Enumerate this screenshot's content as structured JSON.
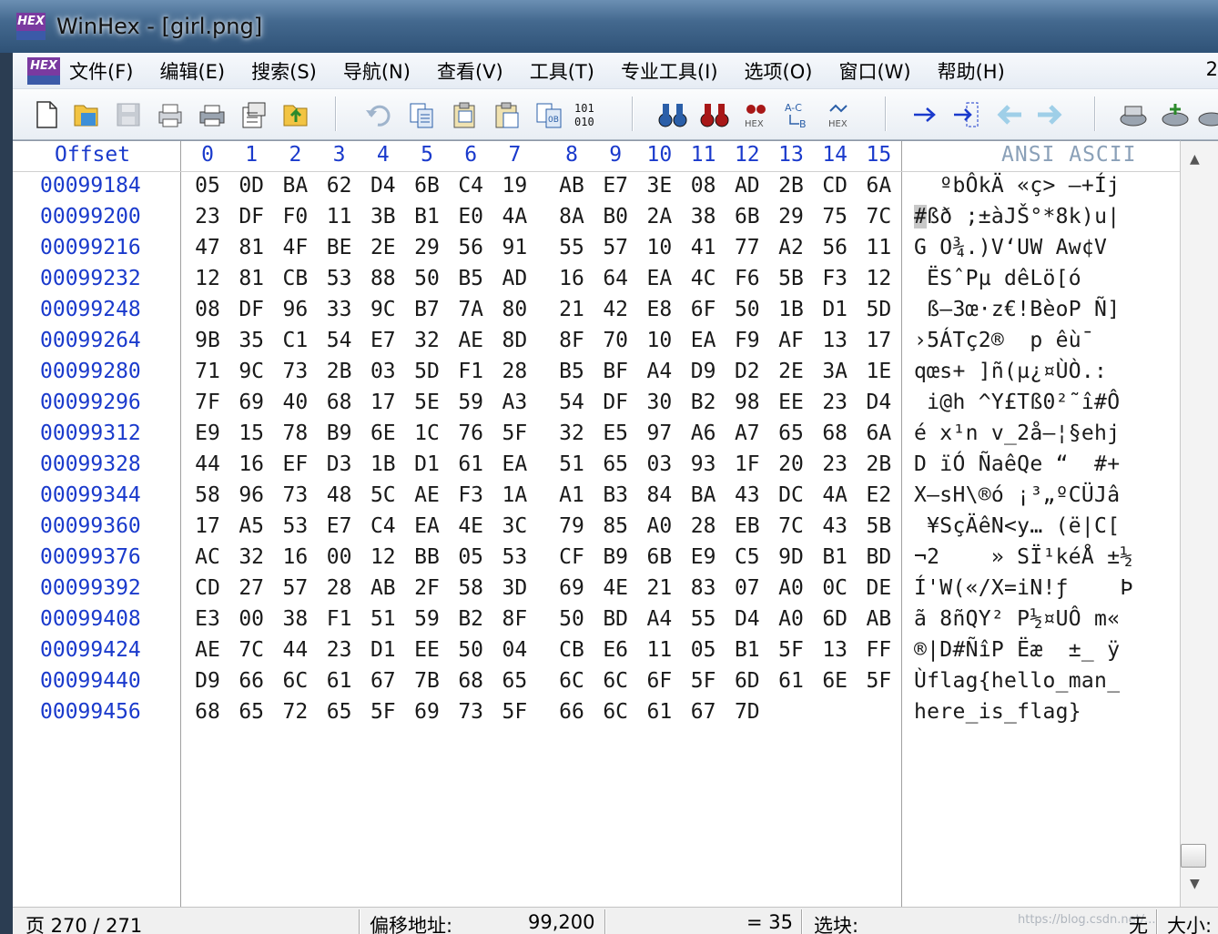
{
  "window": {
    "title": "WinHex - [girl.png]",
    "logo_text": "HEX"
  },
  "menu": {
    "items": [
      "文件(F)",
      "编辑(E)",
      "搜索(S)",
      "导航(N)",
      "查看(V)",
      "工具(T)",
      "专业工具(I)",
      "选项(O)",
      "窗口(W)",
      "帮助(H)"
    ],
    "right_text": "2"
  },
  "toolbar": {
    "icons": [
      "new-file-icon",
      "open-file-icon",
      "save-icon",
      "print-setup-icon",
      "print-icon",
      "properties-icon",
      "export-icon",
      "undo-icon",
      "copy-icon",
      "paste-special-icon",
      "clipboard-icon",
      "copy-hex-icon",
      "binary-convert-icon",
      "find-text-icon",
      "find-hex-icon",
      "replace-hex-icon",
      "replace-text-icon",
      "go-to-hex-icon",
      "goto-offset-icon",
      "goto-block-icon",
      "back-icon",
      "forward-icon",
      "disk-icon",
      "disk-add-icon",
      "disk-open-icon"
    ],
    "binary_text": "101\n010",
    "hex_text": "HEX"
  },
  "hex": {
    "offset_label": "Offset",
    "ansi_label": "ANSI ASCII",
    "columns": [
      "0",
      "1",
      "2",
      "3",
      "4",
      "5",
      "6",
      "7",
      "8",
      "9",
      "10",
      "11",
      "12",
      "13",
      "14",
      "15"
    ],
    "rows": [
      {
        "offset": "00099184",
        "bytes": [
          "05",
          "0D",
          "BA",
          "62",
          "D4",
          "6B",
          "C4",
          "19",
          "AB",
          "E7",
          "3E",
          "08",
          "AD",
          "2B",
          "CD",
          "6A"
        ],
        "ascii": "  ºbÔkÄ «ç> –+Íj"
      },
      {
        "offset": "00099200",
        "bytes": [
          "23",
          "DF",
          "F0",
          "11",
          "3B",
          "B1",
          "E0",
          "4A",
          "8A",
          "B0",
          "2A",
          "38",
          "6B",
          "29",
          "75",
          "7C"
        ],
        "ascii": "#ßð ;±àJŠ°*8k)u|"
      },
      {
        "offset": "00099216",
        "bytes": [
          "47",
          "81",
          "4F",
          "BE",
          "2E",
          "29",
          "56",
          "91",
          "55",
          "57",
          "10",
          "41",
          "77",
          "A2",
          "56",
          "11"
        ],
        "ascii": "G O¾.)V‘UW Aw¢V"
      },
      {
        "offset": "00099232",
        "bytes": [
          "12",
          "81",
          "CB",
          "53",
          "88",
          "50",
          "B5",
          "AD",
          "16",
          "64",
          "EA",
          "4C",
          "F6",
          "5B",
          "F3",
          "12"
        ],
        "ascii": " ËSˆPµ­ dêLö[ó"
      },
      {
        "offset": "00099248",
        "bytes": [
          "08",
          "DF",
          "96",
          "33",
          "9C",
          "B7",
          "7A",
          "80",
          "21",
          "42",
          "E8",
          "6F",
          "50",
          "1B",
          "D1",
          "5D"
        ],
        "ascii": " ß–3œ·z€!BèoP Ñ]"
      },
      {
        "offset": "00099264",
        "bytes": [
          "9B",
          "35",
          "C1",
          "54",
          "E7",
          "32",
          "AE",
          "8D",
          "8F",
          "70",
          "10",
          "EA",
          "F9",
          "AF",
          "13",
          "17"
        ],
        "ascii": "›5ÁTç2®  p êù¯"
      },
      {
        "offset": "00099280",
        "bytes": [
          "71",
          "9C",
          "73",
          "2B",
          "03",
          "5D",
          "F1",
          "28",
          "B5",
          "BF",
          "A4",
          "D9",
          "D2",
          "2E",
          "3A",
          "1E"
        ],
        "ascii": "qœs+ ]ñ(µ¿¤ÙÒ.:"
      },
      {
        "offset": "00099296",
        "bytes": [
          "7F",
          "69",
          "40",
          "68",
          "17",
          "5E",
          "59",
          "A3",
          "54",
          "DF",
          "30",
          "B2",
          "98",
          "EE",
          "23",
          "D4"
        ],
        "ascii": " i@h ^Y£Tß0²˜î#Ô"
      },
      {
        "offset": "00099312",
        "bytes": [
          "E9",
          "15",
          "78",
          "B9",
          "6E",
          "1C",
          "76",
          "5F",
          "32",
          "E5",
          "97",
          "A6",
          "A7",
          "65",
          "68",
          "6A"
        ],
        "ascii": "é x¹n v_2å—¦§ehj"
      },
      {
        "offset": "00099328",
        "bytes": [
          "44",
          "16",
          "EF",
          "D3",
          "1B",
          "D1",
          "61",
          "EA",
          "51",
          "65",
          "03",
          "93",
          "1F",
          "20",
          "23",
          "2B"
        ],
        "ascii": "D ïÓ ÑaêQe “  #+"
      },
      {
        "offset": "00099344",
        "bytes": [
          "58",
          "96",
          "73",
          "48",
          "5C",
          "AE",
          "F3",
          "1A",
          "A1",
          "B3",
          "84",
          "BA",
          "43",
          "DC",
          "4A",
          "E2"
        ],
        "ascii": "X–sH\\®ó ¡³„ºCÜJâ"
      },
      {
        "offset": "00099360",
        "bytes": [
          "17",
          "A5",
          "53",
          "E7",
          "C4",
          "EA",
          "4E",
          "3C",
          "79",
          "85",
          "A0",
          "28",
          "EB",
          "7C",
          "43",
          "5B"
        ],
        "ascii": " ¥SçÄêN<y… (ë|C["
      },
      {
        "offset": "00099376",
        "bytes": [
          "AC",
          "32",
          "16",
          "00",
          "12",
          "BB",
          "05",
          "53",
          "CF",
          "B9",
          "6B",
          "E9",
          "C5",
          "9D",
          "B1",
          "BD"
        ],
        "ascii": "¬2    » SÏ¹kéÅ ±½"
      },
      {
        "offset": "00099392",
        "bytes": [
          "CD",
          "27",
          "57",
          "28",
          "AB",
          "2F",
          "58",
          "3D",
          "69",
          "4E",
          "21",
          "83",
          "07",
          "A0",
          "0C",
          "DE"
        ],
        "ascii": "Í'W(«/X=iN!ƒ    Þ"
      },
      {
        "offset": "00099408",
        "bytes": [
          "E3",
          "00",
          "38",
          "F1",
          "51",
          "59",
          "B2",
          "8F",
          "50",
          "BD",
          "A4",
          "55",
          "D4",
          "A0",
          "6D",
          "AB"
        ],
        "ascii": "ã 8ñQY² P½¤UÔ m«"
      },
      {
        "offset": "00099424",
        "bytes": [
          "AE",
          "7C",
          "44",
          "23",
          "D1",
          "EE",
          "50",
          "04",
          "CB",
          "E6",
          "11",
          "05",
          "B1",
          "5F",
          "13",
          "FF"
        ],
        "ascii": "®|D#ÑîP Ëæ  ±_ ÿ"
      },
      {
        "offset": "00099440",
        "bytes": [
          "D9",
          "66",
          "6C",
          "61",
          "67",
          "7B",
          "68",
          "65",
          "6C",
          "6C",
          "6F",
          "5F",
          "6D",
          "61",
          "6E",
          "5F"
        ],
        "ascii": "Ùflag{hello_man_"
      },
      {
        "offset": "00099456",
        "bytes": [
          "68",
          "65",
          "72",
          "65",
          "5F",
          "69",
          "73",
          "5F",
          "66",
          "6C",
          "61",
          "67",
          "7D"
        ],
        "ascii": "here_is_flag}"
      }
    ]
  },
  "status": {
    "page": "页 270 / 271",
    "offset_label": "偏移地址:",
    "offset_value": "99,200",
    "value_text": "= 35",
    "block_label": "选块:",
    "right_none": "无",
    "right_size": "大小:",
    "watermark": "https://blog.csdn.net/..."
  }
}
